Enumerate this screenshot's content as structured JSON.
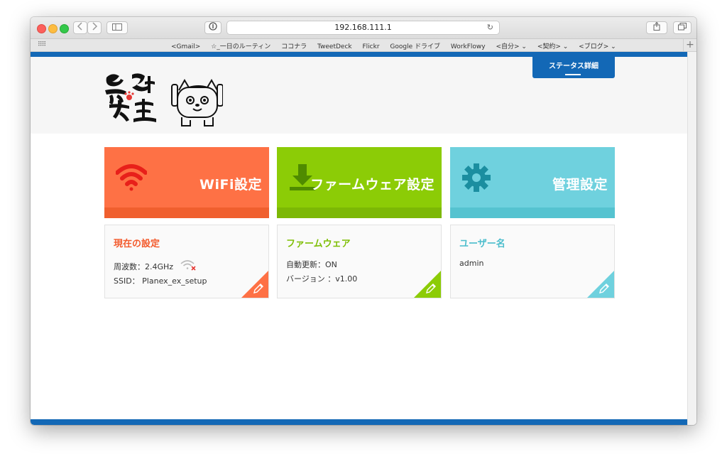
{
  "browser": {
    "url": "192.168.111.1",
    "bookmarks": [
      "<Gmail>",
      "☆_一日のルーティン",
      "ココナラ",
      "TweetDeck",
      "Flickr",
      "Google ドライブ",
      "WorkFlowy",
      "<自分> ⌄",
      "<契約> ⌄",
      "<ブログ> ⌄"
    ]
  },
  "header": {
    "status_link": "ステータス詳細"
  },
  "tiles": {
    "wifi": "WiFi設定",
    "firmware": "ファームウェア設定",
    "admin": "管理設定"
  },
  "cards": {
    "current": {
      "title": "現在の設定",
      "freq": "周波数：2.4GHz",
      "ssid": "SSID：  Planex_ex_setup"
    },
    "firmware": {
      "title": "ファームウェア",
      "auto_update": "自動更新：ON",
      "version": "バージョン  ：v1.00"
    },
    "user": {
      "title": "ユーザー名",
      "name": "admin"
    }
  },
  "colors": {
    "brand_blue": "#1368b6",
    "wifi_orange": "#fe7145",
    "firmware_green": "#8ccc06",
    "admin_cyan": "#6fd1de"
  }
}
